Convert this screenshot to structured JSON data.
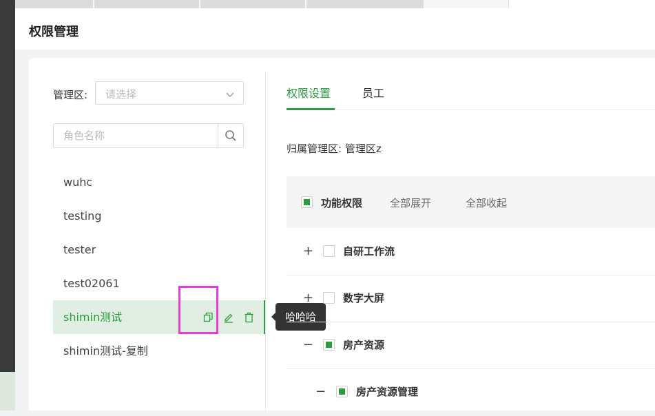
{
  "header": {
    "title": "权限管理"
  },
  "filter": {
    "area_label": "管理区:",
    "area_placeholder": "请选择",
    "role_search_placeholder": "角色名称"
  },
  "roles": [
    {
      "name": "wuhc",
      "active": false
    },
    {
      "name": "testing",
      "active": false
    },
    {
      "name": "tester",
      "active": false
    },
    {
      "name": "test02061",
      "active": false
    },
    {
      "name": "shimin测试",
      "active": true
    },
    {
      "name": "shimin测试-复制",
      "active": false
    }
  ],
  "tooltip": {
    "text": "哈哈哈"
  },
  "tabs": [
    {
      "label": "权限设置",
      "active": true
    },
    {
      "label": "员工",
      "active": false
    }
  ],
  "belong_area": "归属管理区: 管理区z",
  "permissions": {
    "header": {
      "label": "功能权限",
      "expand_all": "全部展开",
      "collapse_all": "全部收起"
    },
    "items": [
      {
        "toggle": "+",
        "label": "自研工作流",
        "checked": "none",
        "level": 0
      },
      {
        "toggle": "+",
        "label": "数字大屏",
        "checked": "none",
        "level": 0
      },
      {
        "toggle": "−",
        "label": "房产资源",
        "checked": "partial",
        "level": 0
      },
      {
        "toggle": "−",
        "label": "房产资源管理",
        "checked": "partial",
        "level": 1
      }
    ]
  },
  "colors": {
    "accent": "#2a9d3c",
    "active_row_bg": "#e0eee3",
    "highlight": "#e53ed8"
  }
}
